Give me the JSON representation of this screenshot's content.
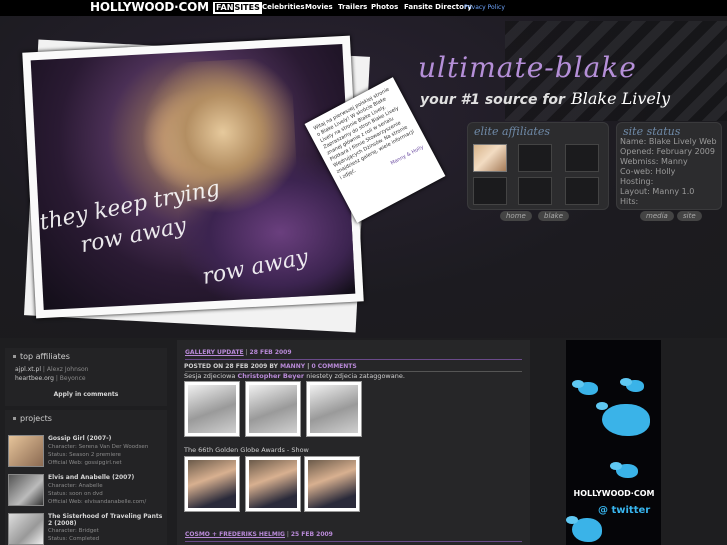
{
  "topbar": {
    "logo": "HOLLYWOOD·COM",
    "fansites_a": "FAN",
    "fansites_b": "SITES",
    "nav": [
      "Celebrities",
      "Movies",
      "Trailers",
      "Photos",
      "Fansite Directory"
    ],
    "privacy": "Privacy Policy"
  },
  "header": {
    "title": "ultimate-blake",
    "subtitle": "your #1 source for",
    "subtitle_cursive": "Blake Lively",
    "scribble_1": "they keep trying",
    "scribble_2": "row away",
    "scribble_3": "row away",
    "note_text": "Witaj na pierwszej polskiej stronie o Blake Lively! W skrócie Blake Lively na stronie Blake Lively. Zapraszamy do stron Blake Lively znanej głównie z roli w serialu Plotkara i filmie Stowarzyszenie Wędrujących Dżinsów. Na stronie znajdziesz galerię, wiele informacji i zdjęć.",
    "note_sign": "Manny & Holly"
  },
  "elite": {
    "title": "elite affiliates"
  },
  "status": {
    "title": "site status",
    "lines": [
      "Name: Blake Lively Web",
      "Opened: February 2009",
      "Webmiss: Manny",
      "Co-web:  Holly",
      "Hosting:",
      "Layout: Manny 1.0",
      "Hits:"
    ]
  },
  "tags": [
    "home",
    "blake",
    "media",
    "site"
  ],
  "sidebar": {
    "top_affiliates_title": "top affiliates",
    "affiliates": [
      {
        "link": "ajpl.xt.pl",
        "sep": " | ",
        "name": "Alexz Johnson"
      },
      {
        "link": "heartbee.org",
        "sep": " | ",
        "name": "Beyonce"
      }
    ],
    "apply": "Apply in comments",
    "projects_title": "projects",
    "projects": [
      {
        "title": "Gossip Girl (2007-)",
        "character": "Character: Serena Van Der Woodsen",
        "status": "Status: Season 2 premiere",
        "web": "Official Web: gossipgirl.net"
      },
      {
        "title": "Elvis and Anabelle (2007)",
        "character": "Character: Anabelle",
        "status": "Status: soon on dvd",
        "web": "Official Web: elvisandanabelle.com/"
      },
      {
        "title": "The Sisterhood of Traveling Pants 2 (2008)",
        "character": "Character: Bridget",
        "status": "Status: Completed",
        "web": ""
      }
    ]
  },
  "main": {
    "post1": {
      "category": "GALLERY UPDATE",
      "date": "28 FEB 2009",
      "meta_prefix": "POSTED ON 28 FEB 2009 BY",
      "author": "MANNY",
      "comments": "0 COMMENTS",
      "text_a": "Sesja zdjeciowa",
      "text_b": "Christopher Beyer",
      "text_c": "niestety zdjecia zataggowane.",
      "text2": "The 66th Golden Globe Awards - Show"
    },
    "post2": {
      "category": "COSMO + FREDERIKS HELMIG",
      "date": "25 FEB 2009"
    }
  },
  "ad": {
    "logo": "HOLLYWOOD·COM",
    "at": "@",
    "twitter": "twitter"
  }
}
